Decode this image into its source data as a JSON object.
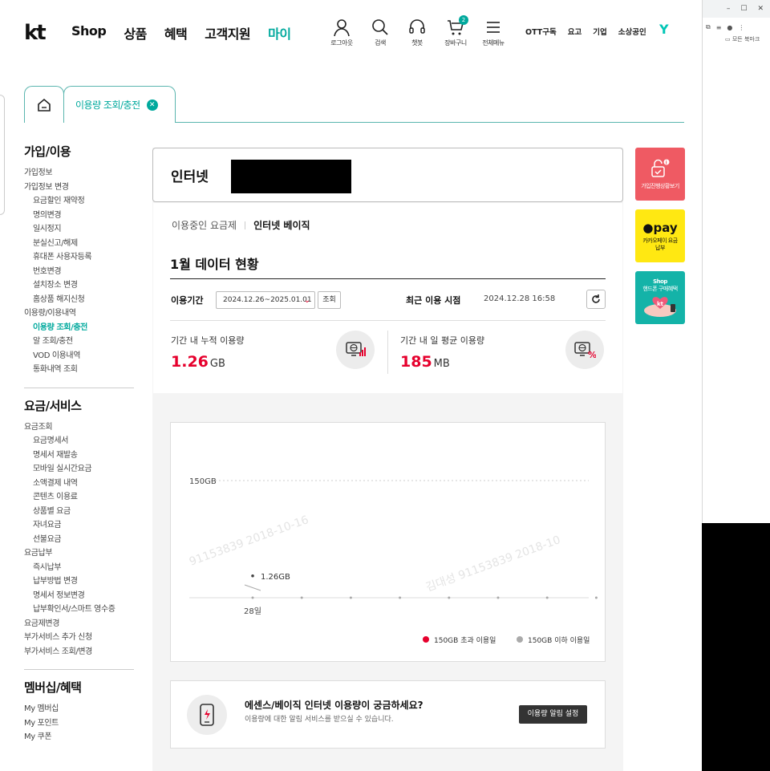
{
  "header": {
    "logo": "kt",
    "gnb": [
      "Shop",
      "상품",
      "혜택",
      "고객지원",
      "마이"
    ],
    "utils": [
      {
        "icon": "user-icon",
        "label": "로그아웃"
      },
      {
        "icon": "search-icon",
        "label": "검색"
      },
      {
        "icon": "headset-icon",
        "label": "챗봇"
      },
      {
        "icon": "cart-icon",
        "label": "장바구니",
        "badge": "2"
      },
      {
        "icon": "menu-icon",
        "label": "전체메뉴"
      }
    ],
    "top_links": [
      "OTT구독",
      "요고",
      "기업",
      "소상공인"
    ],
    "y_logo": "Y"
  },
  "browser": {
    "window_controls": [
      "–",
      "☐",
      "✕"
    ],
    "bookmark_label": "모든 북마크"
  },
  "tabs": {
    "current": "이용량 조회/충전",
    "close_symbol": "✕"
  },
  "sidebar": {
    "sections": [
      {
        "title": "가입/이용",
        "items": [
          {
            "label": "가입정보",
            "level": 0
          },
          {
            "label": "가입정보 변경",
            "level": 0
          },
          {
            "label": "요금할인 재약정",
            "level": 1
          },
          {
            "label": "명의변경",
            "level": 1
          },
          {
            "label": "일시정지",
            "level": 1
          },
          {
            "label": "분실신고/해제",
            "level": 1
          },
          {
            "label": "휴대폰 사용자등록",
            "level": 1
          },
          {
            "label": "번호변경",
            "level": 1
          },
          {
            "label": "설치장소 변경",
            "level": 1
          },
          {
            "label": "홈상품 해지신청",
            "level": 1
          },
          {
            "label": "이용량/이용내역",
            "level": 0
          },
          {
            "label": "이용량 조회/충전",
            "level": 1,
            "active": true
          },
          {
            "label": "알 조회/충전",
            "level": 1
          },
          {
            "label": "VOD 이용내역",
            "level": 1
          },
          {
            "label": "통화내역 조회",
            "level": 1
          }
        ]
      },
      {
        "title": "요금/서비스",
        "items": [
          {
            "label": "요금조회",
            "level": 0
          },
          {
            "label": "요금명세서",
            "level": 1
          },
          {
            "label": "명세서 재발송",
            "level": 1
          },
          {
            "label": "모바일 실시간요금",
            "level": 1
          },
          {
            "label": "소액결제 내역",
            "level": 1
          },
          {
            "label": "콘텐츠 이용료",
            "level": 1
          },
          {
            "label": "상품별 요금",
            "level": 1
          },
          {
            "label": "자녀요금",
            "level": 1
          },
          {
            "label": "선불요금",
            "level": 1
          },
          {
            "label": "요금납부",
            "level": 0
          },
          {
            "label": "즉시납부",
            "level": 1
          },
          {
            "label": "납부방법 변경",
            "level": 1
          },
          {
            "label": "명세서 정보변경",
            "level": 1
          },
          {
            "label": "납부확인서/스마트 영수증",
            "level": 1
          },
          {
            "label": "요금제변경",
            "level": 0
          },
          {
            "label": "부가서비스 추가 신청",
            "level": 0
          },
          {
            "label": "부가서비스 조회/변경",
            "level": 0
          }
        ]
      },
      {
        "title": "멤버십/혜택",
        "items": [
          {
            "label": "My 멤버십",
            "level": 0
          },
          {
            "label": "My 포인트",
            "level": 0
          },
          {
            "label": "My 쿠폰",
            "level": 0
          }
        ]
      }
    ]
  },
  "main": {
    "title": "인터넷",
    "plan_label": "이용중인 요금제",
    "plan_name": "인터넷 베이직",
    "month_title": "1월 데이터 현황",
    "period_label": "이용기간",
    "period_value": "2024.12.26~2025.01.01",
    "query_button": "조회",
    "recent_label": "최근 이용 시점",
    "recent_value": "2024.12.28 16:58",
    "stats": [
      {
        "label": "기간 내 누적 이용량",
        "value": "1.26",
        "unit": "GB",
        "icon": "globe-bar-icon"
      },
      {
        "label": "기간 내 일 평균 이용량",
        "value": "185",
        "unit": "MB",
        "icon": "globe-percent-icon"
      }
    ]
  },
  "chart_data": {
    "type": "scatter",
    "x": [
      "28일",
      "",
      "",
      "",
      "",
      "",
      "",
      ""
    ],
    "points": [
      {
        "x": "28일",
        "y": 1.26,
        "label": "1.26GB"
      }
    ],
    "reference_line": {
      "value": 150,
      "label": "150GB"
    },
    "legend": [
      {
        "name": "150GB 초과 이용일",
        "color": "#e6002d"
      },
      {
        "name": "150GB 이하 이용일",
        "color": "#aaaaaa"
      }
    ],
    "legend_position": "bottom-right",
    "watermarks": [
      "91153839 2018-10-16",
      "김대성 91153839 2018-10"
    ]
  },
  "notice": {
    "title": "에센스/베이직 인터넷 이용량이 궁금하세요?",
    "desc": "이용량에 대한 알림 서비스를 받으실 수 있습니다.",
    "button": "이용량 알림 설정"
  },
  "banners": {
    "b1_text": "가입진행상황보기",
    "b2_pay": "pay",
    "b2_text": "카카오페이 요금납부",
    "b3_top": "Shop",
    "b3_text": "핸드폰 구매혜택"
  },
  "colors": {
    "accent": "#00a99d",
    "red": "#e6002d",
    "kakao": "#ffe812"
  }
}
